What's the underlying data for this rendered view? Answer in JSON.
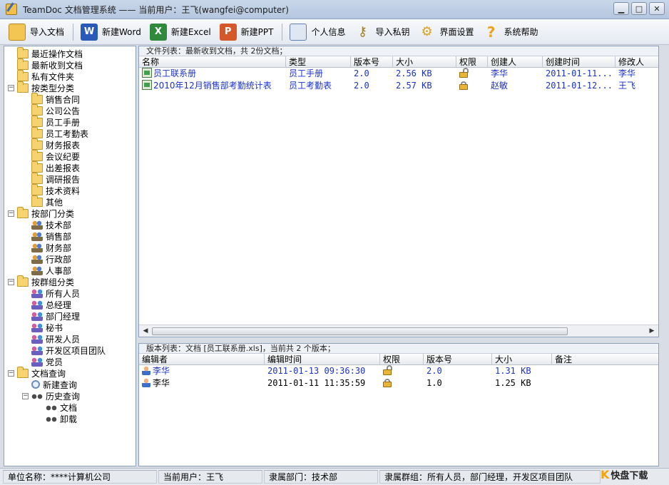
{
  "window": {
    "title": "TeamDoc 文档管理系统 —— 当前用户：王飞(wangfei@computer)",
    "controls": [
      "▁",
      "□",
      "✕"
    ]
  },
  "toolbar": {
    "buttons": [
      {
        "label": "导入文档",
        "icon": "import-folder-icon"
      },
      {
        "label": "新建Word",
        "icon": "word-icon"
      },
      {
        "label": "新建Excel",
        "icon": "excel-icon"
      },
      {
        "label": "新建PPT",
        "icon": "ppt-icon"
      },
      {
        "label": "个人信息",
        "icon": "profile-card-icon"
      },
      {
        "label": "导入私钥",
        "icon": "key-icon"
      },
      {
        "label": "界面设置",
        "icon": "gears-icon"
      },
      {
        "label": "系统帮助",
        "icon": "question-icon"
      }
    ]
  },
  "tree": {
    "items": [
      {
        "label": "最近操作文档",
        "icon": "folder-recent"
      },
      {
        "label": "最新收到文档",
        "icon": "folder-new"
      },
      {
        "label": "私有文件夹",
        "icon": "folder-private"
      },
      {
        "label": "按类型分类",
        "icon": "folder",
        "toggle": "−"
      },
      {
        "label": "销售合同",
        "icon": "folder"
      },
      {
        "label": "公司公告",
        "icon": "folder"
      },
      {
        "label": "员工手册",
        "icon": "folder"
      },
      {
        "label": "员工考勤表",
        "icon": "folder"
      },
      {
        "label": "财务报表",
        "icon": "folder"
      },
      {
        "label": "会议纪要",
        "icon": "folder"
      },
      {
        "label": "出差报表",
        "icon": "folder"
      },
      {
        "label": "调研报告",
        "icon": "folder"
      },
      {
        "label": "技术资料",
        "icon": "folder"
      },
      {
        "label": "其他",
        "icon": "folder"
      },
      {
        "label": "按部门分类",
        "icon": "folder",
        "toggle": "−"
      },
      {
        "label": "技术部",
        "icon": "people"
      },
      {
        "label": "销售部",
        "icon": "people"
      },
      {
        "label": "财务部",
        "icon": "people"
      },
      {
        "label": "行政部",
        "icon": "people"
      },
      {
        "label": "人事部",
        "icon": "people"
      },
      {
        "label": "按群组分类",
        "icon": "folder",
        "toggle": "−"
      },
      {
        "label": "所有人员",
        "icon": "group"
      },
      {
        "label": "总经理",
        "icon": "group"
      },
      {
        "label": "部门经理",
        "icon": "group"
      },
      {
        "label": "秘书",
        "icon": "group"
      },
      {
        "label": "研发人员",
        "icon": "group"
      },
      {
        "label": "开发区项目团队",
        "icon": "group"
      },
      {
        "label": "党员",
        "icon": "group"
      },
      {
        "label": "文档查询",
        "icon": "folder",
        "toggle": "−"
      },
      {
        "label": "新建查询",
        "icon": "search"
      },
      {
        "label": "历史查询",
        "icon": "bino",
        "toggle": "−"
      },
      {
        "label": "文档",
        "icon": "bino"
      },
      {
        "label": "卸载",
        "icon": "bino"
      }
    ]
  },
  "file_list": {
    "caption": "文件列表：最新收到文档，共 2份文档；",
    "columns": [
      "名称",
      "类型",
      "版本号",
      "大小",
      "权限",
      "创建人",
      "创建时间",
      "修改人"
    ],
    "rows": [
      {
        "name": "员工联系册",
        "type": "员工手册",
        "version": "2.0",
        "size": "2.56 KB",
        "perm": "unlocked",
        "creator": "李华",
        "created": "2011-01-11...",
        "modifier": "李华"
      },
      {
        "name": "2010年12月销售部考勤统计表",
        "type": "员工考勤表",
        "version": "2.0",
        "size": "2.57 KB",
        "perm": "locked",
        "creator": "赵敏",
        "created": "2011-01-12...",
        "modifier": "王飞"
      }
    ]
  },
  "version_list": {
    "caption": "版本列表：文档 [员工联系册.xls]，当前共 2 个版本；",
    "columns": [
      "编辑者",
      "编辑时间",
      "权限",
      "版本号",
      "大小",
      "备注"
    ],
    "rows": [
      {
        "editor": "李华",
        "time": "2011-01-13 09:36:30",
        "perm": "unlocked",
        "version": "2.0",
        "size": "1.31 KB",
        "note": ""
      },
      {
        "editor": "李华",
        "time": "2011-01-11 11:35:59",
        "perm": "locked",
        "version": "1.0",
        "size": "1.25 KB",
        "note": ""
      }
    ]
  },
  "status": {
    "company": "单位名称：****计算机公司",
    "user": "当前用户：王飞",
    "dept": "隶属部门：技术部",
    "groups": "隶属群组：所有人员，部门经理，开发区项目团队"
  },
  "watermark": {
    "mark": "K",
    "text": "快盘下载"
  },
  "colors": {
    "link_blue": "#1a32c8",
    "titlebar": "#c9d7ea",
    "background": "#d8dde6"
  }
}
